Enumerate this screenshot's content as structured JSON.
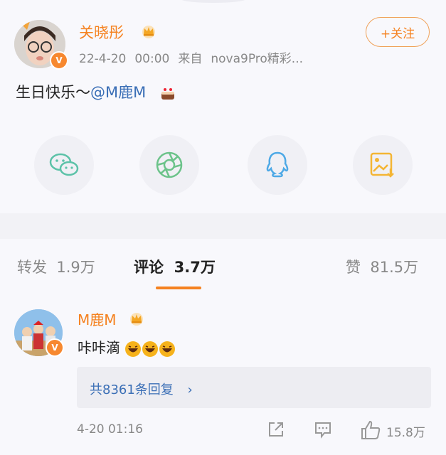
{
  "post": {
    "author": "关晓彤",
    "date": "22-4-20",
    "time": "00:00",
    "source_prefix": "来自",
    "source": "nova9Pro精彩...",
    "follow_label": "+关注",
    "text": "生日快乐～",
    "mention": "@M鹿M",
    "verified_mark": "V"
  },
  "share": [
    "wechat-icon",
    "moments-icon",
    "qq-icon",
    "save-image-icon"
  ],
  "tabs": {
    "repost_label": "转发",
    "repost_count": "1.9万",
    "comment_label": "评论",
    "comment_count": "3.7万",
    "like_label": "赞",
    "like_count": "81.5万"
  },
  "comment": {
    "user": "M鹿M",
    "text": "咔咔滴",
    "replies": "共8361条回复",
    "time": "4-20 01:16",
    "likes": "15.8万",
    "verified_mark": "V"
  },
  "colors": {
    "accent": "#f58220",
    "link": "#3b6fb6",
    "muted": "#888888"
  }
}
